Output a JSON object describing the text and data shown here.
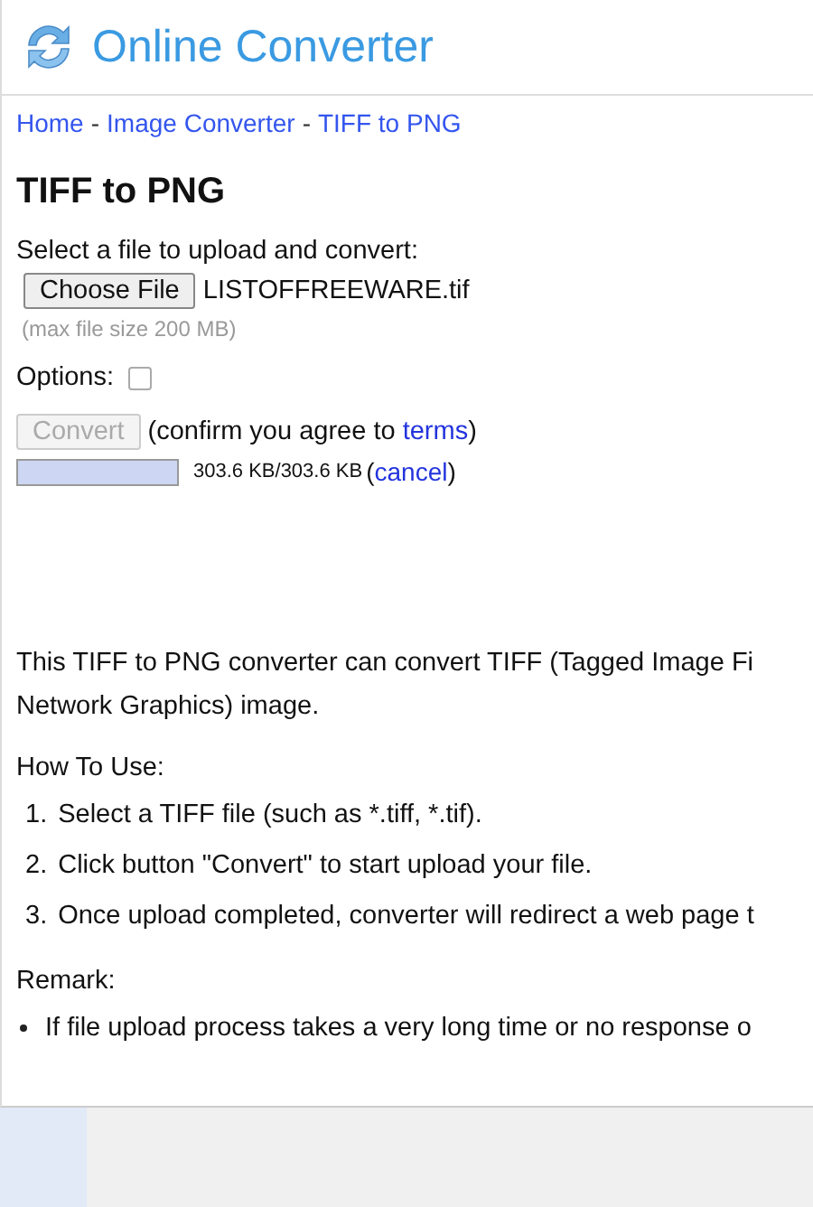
{
  "site": {
    "title": "Online Converter"
  },
  "breadcrumb_separator": "-",
  "breadcrumb": [
    {
      "label": "Home"
    },
    {
      "label": "Image Converter"
    },
    {
      "label": "TIFF to PNG"
    }
  ],
  "heading": "TIFF to PNG",
  "upload": {
    "prompt": "Select a file to upload and convert:",
    "button": "Choose File",
    "file_name": "LISTOFFREEWARE.tif",
    "hint": "(max file size 200 MB)"
  },
  "options": {
    "label": "Options:",
    "checked": false
  },
  "convert": {
    "button": "Convert",
    "disabled": true,
    "note_before": "(confirm you agree to ",
    "terms_link": "terms",
    "note_after": ")"
  },
  "progress": {
    "level": 1,
    "reading": "303.6 KB/303.6 KB",
    "cancel_before": "(",
    "cancel_link": "cancel",
    "cancel_after": ")"
  },
  "intro_lines": [
    "This TIFF to PNG converter can convert TIFF (Tagged Image Fi",
    "Network Graphics) image."
  ],
  "how_to_use": {
    "title": "How To Use:",
    "steps": [
      {
        "number": "1.",
        "text": "Select a TIFF file (such as *.tiff, *.tif)."
      },
      {
        "number": "2.",
        "text": "Click button \"Convert\" to start upload your file."
      },
      {
        "number": "3.",
        "text": "Once upload completed, converter will redirect a web page t"
      }
    ]
  },
  "remark": {
    "title": "Remark:",
    "bullets": [
      "If file upload process takes a very long time or no response o"
    ]
  }
}
